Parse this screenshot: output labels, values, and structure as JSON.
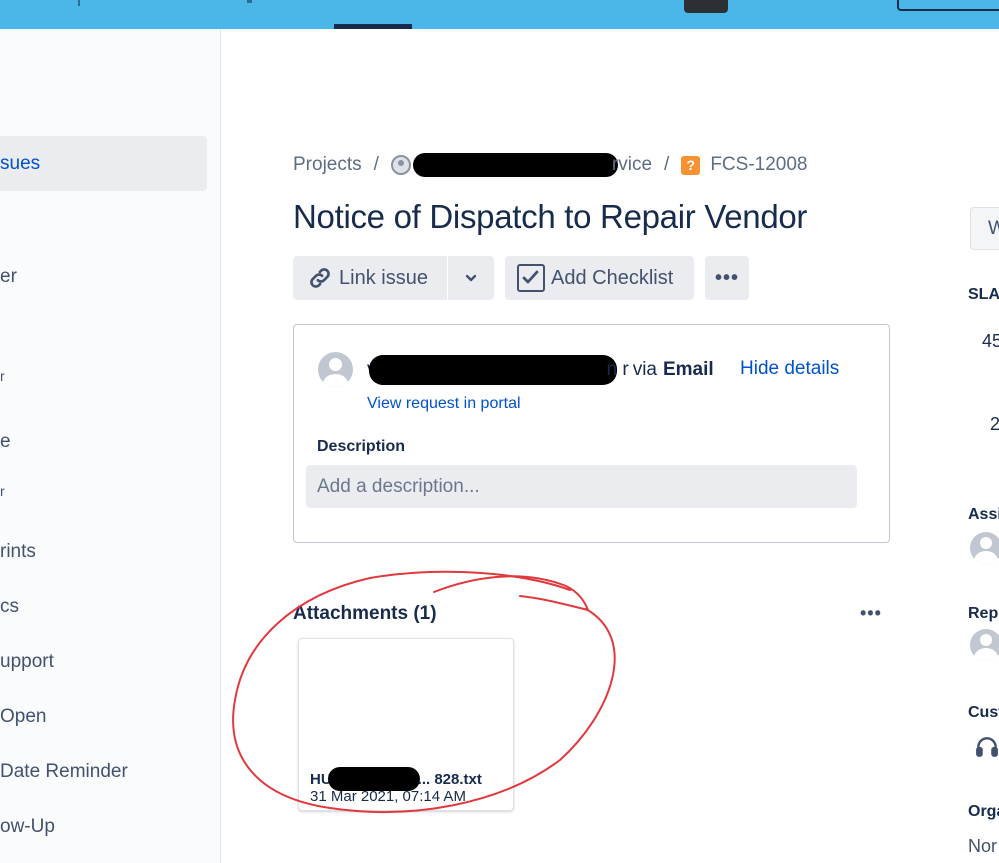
{
  "sidebar": {
    "items": [
      {
        "label": "sues",
        "active": true
      },
      {
        "label": "er"
      },
      {
        "label": "r"
      },
      {
        "label": "e"
      },
      {
        "label": "r"
      },
      {
        "label": "rints"
      },
      {
        "label": "cs"
      },
      {
        "label": "upport"
      },
      {
        "label": "Open"
      },
      {
        "label": "Date Reminder"
      },
      {
        "label": "ow-Up"
      }
    ]
  },
  "breadcrumb": {
    "projects": "Projects",
    "separator": "/",
    "project_tail": "rvice",
    "issue_key": "FCS-12008",
    "issue_type_icon": "?"
  },
  "issue": {
    "title": "Notice of Dispatch to Repair Vendor"
  },
  "toolbar": {
    "link_issue": "Link issue",
    "add_checklist": "Add Checklist",
    "more": "•••"
  },
  "request": {
    "reporter_prefix": "v",
    "reporter_suffix": "n r",
    "via": "via",
    "channel": "Email",
    "hide_details": "Hide details",
    "view_in_portal": "View request in portal",
    "description_label": "Description",
    "description_placeholder": "Add a description..."
  },
  "attachments": {
    "title": "Attachments (1)",
    "more": "•••",
    "items": [
      {
        "name_prefix": "HU",
        "name_suffix": "... 828.txt",
        "date": "31 Mar 2021, 07:14 AM"
      }
    ]
  },
  "right_panel": {
    "button_text": "W",
    "sla_label": "SLA",
    "sla_value_1": "45",
    "sla_value_2": "2",
    "assignee_label": "Assi",
    "reporter_label": "Rep",
    "customer_label": "Cust",
    "organization_label": "Orga",
    "organization_value": "Nor"
  },
  "colors": {
    "topbar": "#4bb7e8",
    "link": "#0052cc",
    "text": "#172b4d",
    "annotation": "#e0393e",
    "issue_type": "#f79232"
  }
}
